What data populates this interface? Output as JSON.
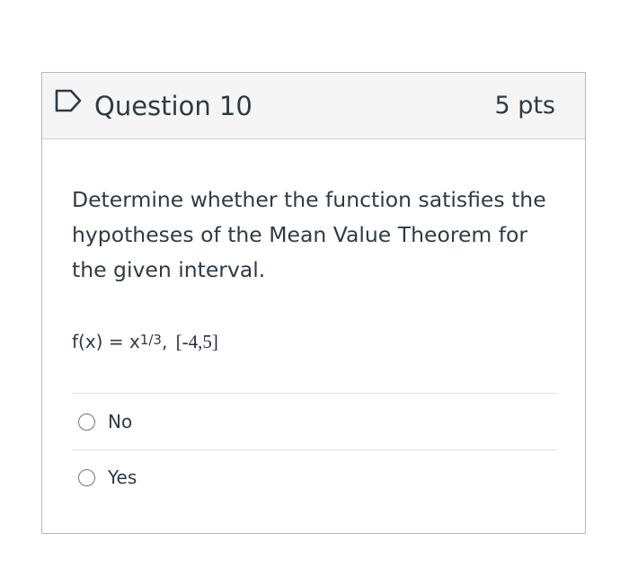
{
  "question": {
    "title": "Question 10",
    "points": "5 pts",
    "text": "Determine whether the function satisfies the hypotheses of the Mean Value Theorem for the given interval.",
    "formula_base": "f(x) = x",
    "formula_exponent": "1/3",
    "formula_separator": ",",
    "interval": "[-4,5]"
  },
  "answers": [
    {
      "label": "No",
      "selected": false
    },
    {
      "label": "Yes",
      "selected": false
    }
  ],
  "icons": {
    "flag": "flag-outline-icon",
    "radio": "radio-unchecked-icon"
  },
  "colors": {
    "text": "#2d3b45",
    "header_bg": "#f5f5f5",
    "border": "#b4b9bd",
    "divider": "#dfe2e4",
    "radio_border": "#6b7780"
  }
}
